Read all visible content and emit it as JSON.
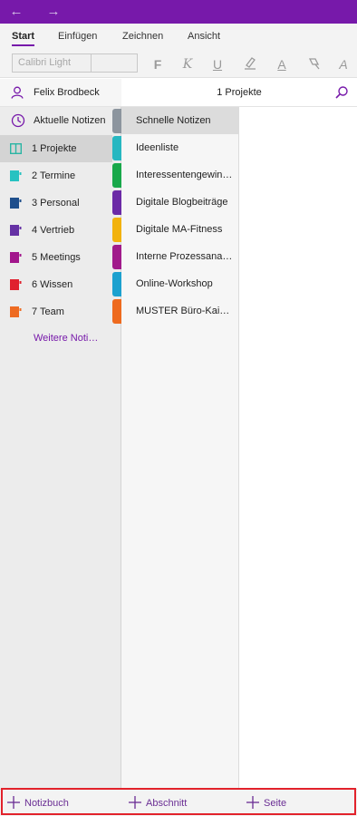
{
  "titlebar": {
    "back_icon": "arrow-left-icon",
    "forward_icon": "arrow-right-icon",
    "color": "#7719aa"
  },
  "ribbon": {
    "tabs": [
      {
        "label": "Start",
        "active": true
      },
      {
        "label": "Einfügen",
        "active": false
      },
      {
        "label": "Zeichnen",
        "active": false
      },
      {
        "label": "Ansicht",
        "active": false
      }
    ],
    "font_name": "Calibri Light",
    "font_size": "",
    "tools": [
      {
        "name": "bold-icon",
        "glyph": "F"
      },
      {
        "name": "italic-icon",
        "glyph": "K"
      },
      {
        "name": "underline-icon",
        "glyph": "U"
      },
      {
        "name": "highlighter-icon",
        "glyph": ""
      },
      {
        "name": "font-color-icon",
        "glyph": "A"
      },
      {
        "name": "format-painter-icon",
        "glyph": ""
      },
      {
        "name": "clear-formatting-icon",
        "glyph": "A"
      }
    ]
  },
  "user": {
    "name": "Felix Brodbeck"
  },
  "section_header": {
    "title": "1 Projekte"
  },
  "notebooks": {
    "recent": {
      "label": "Aktuelle Notizen",
      "tab_color": "#8c959e"
    },
    "items": [
      {
        "label": "1 Projekte",
        "color": "#2bb5a4",
        "icon": "open-notebook-icon",
        "selected": true
      },
      {
        "label": "2 Termine",
        "color": "#26c2c1",
        "icon": "notebook-icon",
        "selected": false
      },
      {
        "label": "3 Personal",
        "color": "#1f4f8c",
        "icon": "notebook-icon",
        "selected": false
      },
      {
        "label": "4 Vertrieb",
        "color": "#6531a4",
        "icon": "notebook-icon",
        "selected": false
      },
      {
        "label": "5 Meetings",
        "color": "#a2168c",
        "icon": "notebook-icon",
        "selected": false
      },
      {
        "label": "6 Wissen",
        "color": "#e0212e",
        "icon": "notebook-icon",
        "selected": false
      },
      {
        "label": "7 Team",
        "color": "#ee6b22",
        "icon": "notebook-icon",
        "selected": false
      }
    ],
    "more_label": "Weitere Notizbücher..."
  },
  "section_tabs": [
    "#27b7c1",
    "#19a84a",
    "#6b2aa6",
    "#f2b20d",
    "#a11b8b",
    "#1ca1cf",
    "#ee6a1e"
  ],
  "sections": [
    {
      "label": "Schnelle Notizen",
      "selected": true
    },
    {
      "label": "Ideenliste",
      "selected": false
    },
    {
      "label": "Interessentengewinnung",
      "selected": false
    },
    {
      "label": "Digitale Blogbeiträge",
      "selected": false
    },
    {
      "label": "Digitale MA-Fitness",
      "selected": false
    },
    {
      "label": "Interne Prozessanalyse",
      "selected": false
    },
    {
      "label": "Online-Workshop",
      "selected": false
    },
    {
      "label": "MUSTER Büro-Kaizen",
      "selected": false
    }
  ],
  "bottom": {
    "add_notebook": "Notizbuch",
    "add_section": "Abschnitt",
    "add_page": "Seite",
    "highlight_color": "#e2222b"
  }
}
